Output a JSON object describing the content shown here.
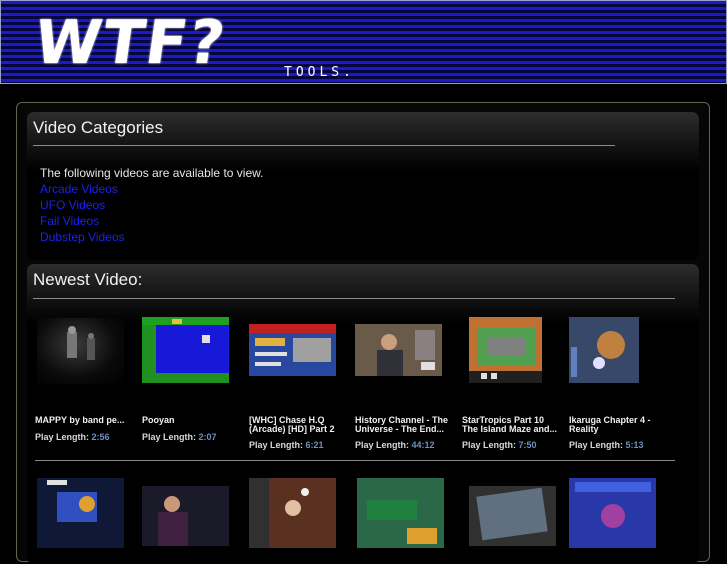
{
  "header": {
    "logo_text": "WTF?",
    "tagline": "TOOLS."
  },
  "categories": {
    "title": "Video Categories",
    "intro": "The following videos are available to view.",
    "links": [
      "Arcade Videos",
      "UFO Videos",
      "Fail Videos",
      "Dubstep Videos"
    ]
  },
  "newest": {
    "title": "Newest Video:",
    "play_length_label": "Play Length:",
    "videos": [
      {
        "title": "MAPPY by band pe...",
        "duration": "2:56",
        "thumb": "band-thumb"
      },
      {
        "title": "Pooyan",
        "duration": "2:07",
        "thumb": "pooyan-thumb"
      },
      {
        "title": "[WHC] Chase H.Q (Arcade) [HD] Part 2",
        "duration": "6:21",
        "thumb": "chasehq-thumb"
      },
      {
        "title": "History Channel - The Universe - The End...",
        "duration": "44:12",
        "thumb": "history-thumb"
      },
      {
        "title": "StarTropics Part 10 The Island Maze and...",
        "duration": "7:50",
        "thumb": "startropics-thumb"
      },
      {
        "title": "Ikaruga Chapter 4 - Reality",
        "duration": "5:13",
        "thumb": "ikaruga-thumb"
      }
    ],
    "second_row_count": 6
  },
  "colors": {
    "link": "#1a22ee",
    "duration": "#6f8fc0",
    "banner_stripe": "#1a1ac8"
  }
}
